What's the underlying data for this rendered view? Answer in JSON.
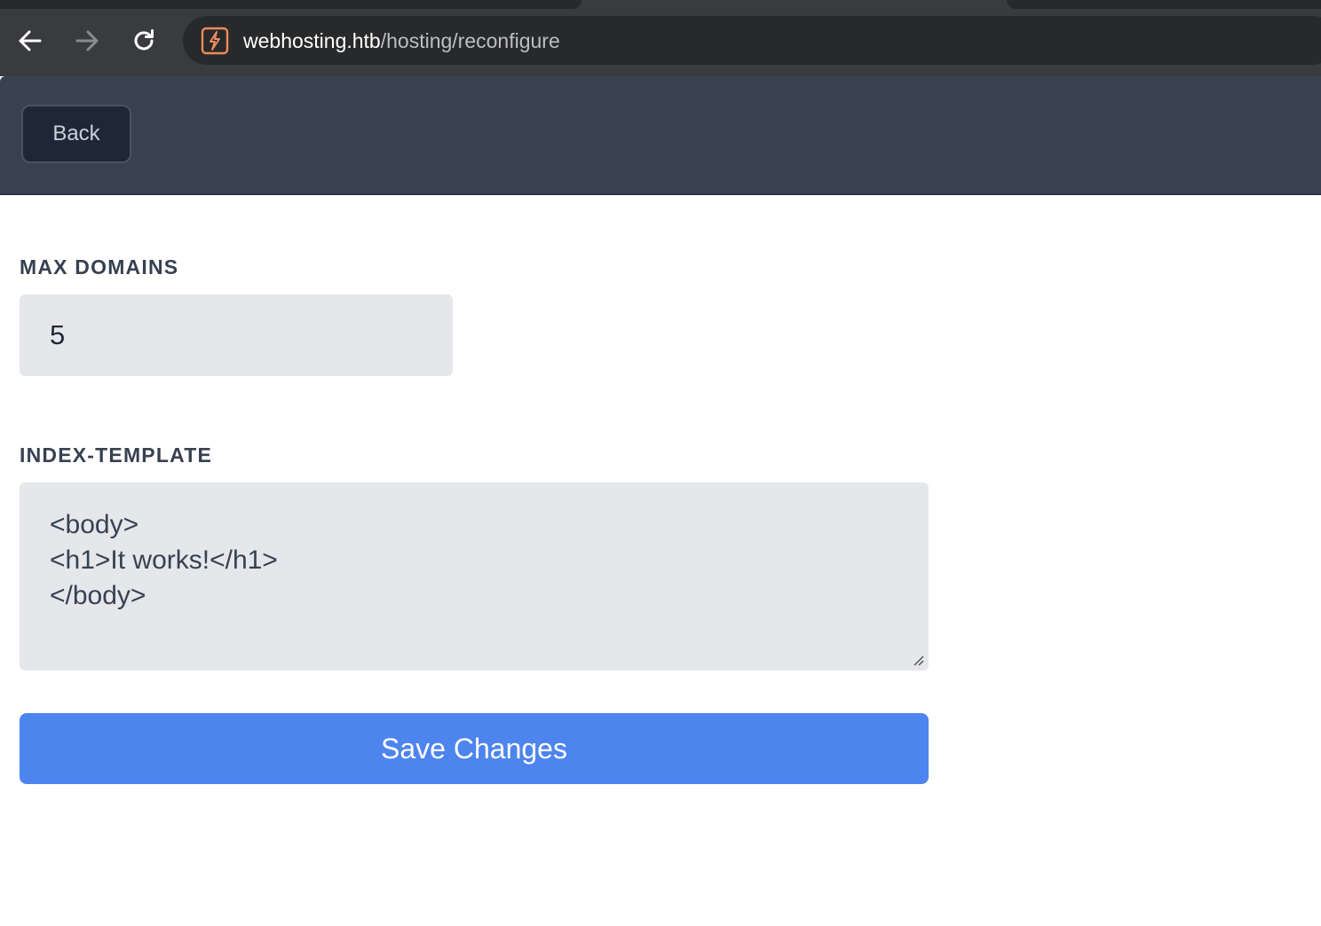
{
  "browser": {
    "url_host": "webhosting.htb",
    "url_path": "/hosting/reconfigure",
    "back_icon": "arrow-left-icon",
    "forward_icon": "arrow-right-icon",
    "reload_icon": "reload-icon",
    "site_icon": "bolt-icon"
  },
  "header": {
    "back_label": "Back"
  },
  "form": {
    "max_domains_label": "MAX DOMAINS",
    "max_domains_value": "5",
    "index_template_label": "INDEX-TEMPLATE",
    "index_template_value": "<body>\n<h1>It works!</h1>\n</body>",
    "save_label": "Save Changes"
  },
  "colors": {
    "header_bg": "#394050",
    "input_bg": "#e5e7eb",
    "accent": "#4e84ee",
    "site_icon": "#f08a5d"
  }
}
